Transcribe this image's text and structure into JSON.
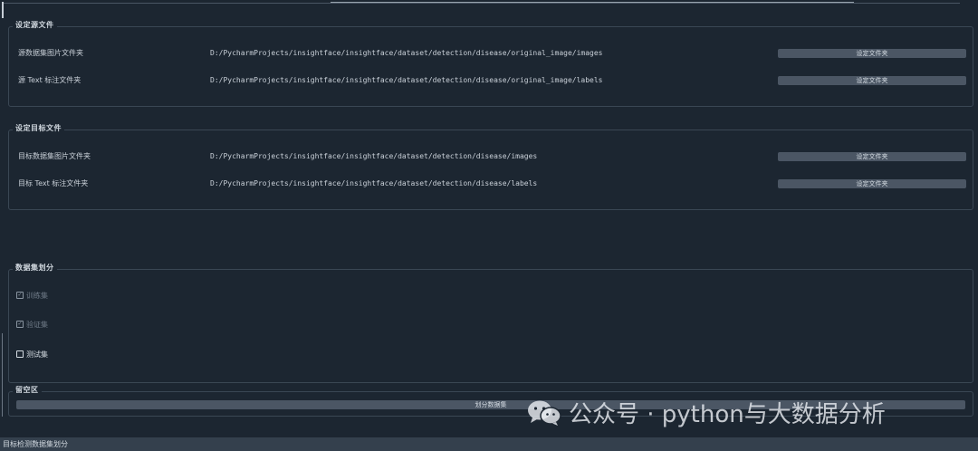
{
  "source_group": {
    "title": "设定源文件",
    "rows": [
      {
        "label": "源数据集图片文件夹",
        "path": "D:/PycharmProjects/insightface/insightface/dataset/detection/disease/original_image/images",
        "button": "设定文件夹"
      },
      {
        "label": "源 Text 标注文件夹",
        "path": "D:/PycharmProjects/insightface/insightface/dataset/detection/disease/original_image/labels",
        "button": "设定文件夹"
      }
    ]
  },
  "target_group": {
    "title": "设定目标文件",
    "rows": [
      {
        "label": "目标数据集图片文件夹",
        "path": "D:/PycharmProjects/insightface/insightface/dataset/detection/disease/images",
        "button": "设定文件夹"
      },
      {
        "label": "目标 Text 标注文件夹",
        "path": "D:/PycharmProjects/insightface/insightface/dataset/detection/disease/labels",
        "button": "设定文件夹"
      }
    ]
  },
  "split_group": {
    "title": "数据集划分",
    "options": [
      {
        "label": "训练集",
        "checked": true,
        "enabled": false
      },
      {
        "label": "验证集",
        "checked": true,
        "enabled": false
      },
      {
        "label": "测试集",
        "checked": false,
        "enabled": true
      }
    ]
  },
  "blank_group": {
    "title": "留空区",
    "button": "划分数据集"
  },
  "status_bar": {
    "text": "目标检测数据集划分"
  },
  "watermark": {
    "text": "公众号 · python与大数据分析",
    "icon": "wechat-icon"
  }
}
